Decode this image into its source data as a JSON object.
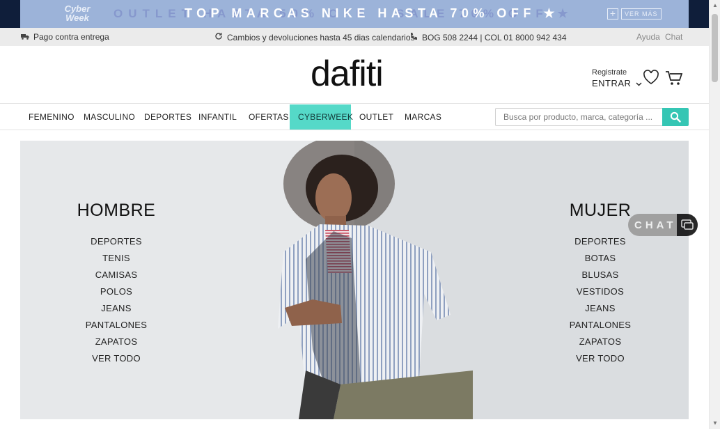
{
  "promo": {
    "logo_line1": "Cyber",
    "logo_line2": "Week",
    "ghost_text": "OUTLET HASTA 50% OFF · SALE 70% OFF ★",
    "main_text": "TOP MARCAS  NIKE HASTA 70% OFF ★",
    "more_label": "VER MÁS"
  },
  "infobar": {
    "delivery": "Pago contra entrega",
    "returns": "Cambios y devoluciones hasta 45 dias calendarios",
    "phone": "BOG 508 2244 | COL 01 8000 942 434",
    "help": "Ayuda",
    "chat": "Chat"
  },
  "header": {
    "logo": "dafiti",
    "register": "Registrate",
    "login": "ENTRAR"
  },
  "nav": {
    "items": [
      "FEMENINO",
      "MASCULINO",
      "DEPORTES",
      "INFANTIL",
      "OFERTAS",
      "CYBERWEEK",
      "OUTLET",
      "MARCAS"
    ],
    "active": "CYBERWEEK",
    "search_placeholder": "Busca por producto, marca, categoría ..."
  },
  "hero": {
    "left_title": "HOMBRE",
    "left_links": [
      "DEPORTES",
      "TENIS",
      "CAMISAS",
      "POLOS",
      "JEANS",
      "PANTALONES",
      "ZAPATOS",
      "VER TODO"
    ],
    "right_title": "MUJER",
    "right_links": [
      "DEPORTES",
      "BOTAS",
      "BLUSAS",
      "VESTIDOS",
      "JEANS",
      "PANTALONES",
      "ZAPATOS",
      "VER TODO"
    ]
  },
  "chat_widget": {
    "label": "CHAT"
  },
  "colors": {
    "accent": "#55d9c8",
    "search_button": "#35c6b4",
    "promo_bg": "#9cb3d9",
    "infobar_bg": "#ebebeb"
  },
  "icons": [
    "truck-icon",
    "refresh-icon",
    "phone-icon",
    "heart-icon",
    "cart-icon",
    "search-icon",
    "chevron-down-icon",
    "chat-bubble-icon",
    "plus-icon"
  ]
}
